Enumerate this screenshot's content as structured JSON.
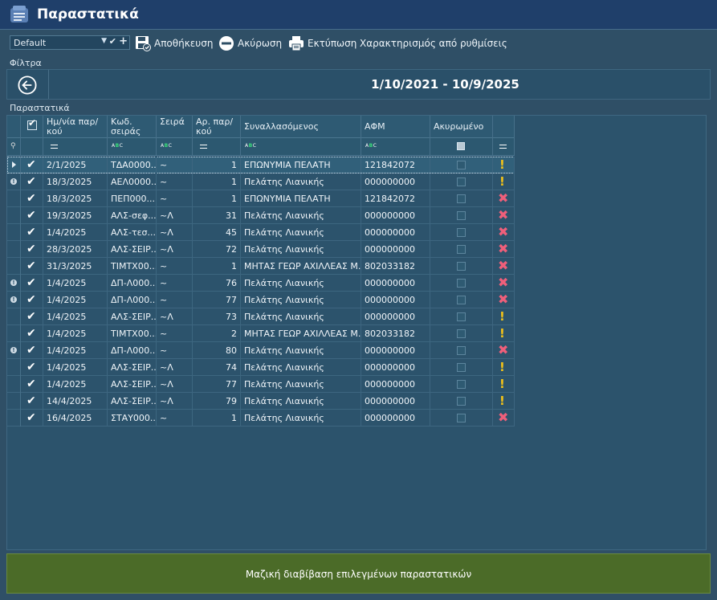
{
  "window": {
    "title": "Παραστατικά"
  },
  "toolbar": {
    "layout_value": "Default",
    "save_label": "Αποθήκευση",
    "cancel_label": "Ακύρωση",
    "print_label": "Εκτύπωση",
    "settings_label": "Χαρακτηρισμός από ρυθμίσεις"
  },
  "filters": {
    "label": "Φίλτρα",
    "date_range": "1/10/2021 - 10/9/2025"
  },
  "grid": {
    "label": "Παραστατικά",
    "columns": {
      "date": "Ημ/νία παρ/κού",
      "series_code": "Κωδ. σειράς",
      "series": "Σειρά",
      "number": "Αρ. παρ/κού",
      "party": "Συναλλασόμενος",
      "vat": "ΑΦΜ",
      "cancelled": "Ακυρωμένο"
    },
    "rows": [
      {
        "date": "2/1/2025",
        "code": "ΤΔΑ0000...",
        "series": "~",
        "num": "1",
        "party": "ΕΠΩΝΥΜΙΑ ΠΕΛΑΤΗ",
        "vat": "121842072",
        "status": "warn",
        "flag": false,
        "selected": true
      },
      {
        "date": "18/3/2025",
        "code": "ΑΕΛ0000...",
        "series": "~",
        "num": "1",
        "party": "Πελάτης Λιανικής",
        "vat": "000000000",
        "status": "warn",
        "flag": true,
        "selected": false
      },
      {
        "date": "18/3/2025",
        "code": "ΠΕΠ000...",
        "series": "~",
        "num": "1",
        "party": "ΕΠΩΝΥΜΙΑ ΠΕΛΑΤΗ",
        "vat": "121842072",
        "status": "error",
        "flag": false,
        "selected": false
      },
      {
        "date": "19/3/2025",
        "code": "ΑΛΣ-σεφ...",
        "series": "~Λ",
        "num": "31",
        "party": "Πελάτης Λιανικής",
        "vat": "000000000",
        "status": "error",
        "flag": false,
        "selected": false
      },
      {
        "date": "1/4/2025",
        "code": "ΑΛΣ-τεσ...",
        "series": "~Λ",
        "num": "45",
        "party": "Πελάτης Λιανικής",
        "vat": "000000000",
        "status": "error",
        "flag": false,
        "selected": false
      },
      {
        "date": "28/3/2025",
        "code": "ΑΛΣ-ΣΕΙΡ...",
        "series": "~Λ",
        "num": "72",
        "party": "Πελάτης Λιανικής",
        "vat": "000000000",
        "status": "error",
        "flag": false,
        "selected": false
      },
      {
        "date": "31/3/2025",
        "code": "ΤΙΜΤΧ00...",
        "series": "~",
        "num": "1",
        "party": "ΜΗΤΑΣ ΓΕΩΡ  ΑΧΙΛΛΕΑΣ Μ...",
        "vat": "802033182",
        "status": "error",
        "flag": false,
        "selected": false
      },
      {
        "date": "1/4/2025",
        "code": "ΔΠ-Λ000...",
        "series": "~",
        "num": "76",
        "party": "Πελάτης Λιανικής",
        "vat": "000000000",
        "status": "error",
        "flag": true,
        "selected": false
      },
      {
        "date": "1/4/2025",
        "code": "ΔΠ-Λ000...",
        "series": "~",
        "num": "77",
        "party": "Πελάτης Λιανικής",
        "vat": "000000000",
        "status": "error",
        "flag": true,
        "selected": false
      },
      {
        "date": "1/4/2025",
        "code": "ΑΛΣ-ΣΕΙΡ...",
        "series": "~Λ",
        "num": "73",
        "party": "Πελάτης Λιανικής",
        "vat": "000000000",
        "status": "warn",
        "flag": false,
        "selected": false
      },
      {
        "date": "1/4/2025",
        "code": "ΤΙΜΤΧ00...",
        "series": "~",
        "num": "2",
        "party": "ΜΗΤΑΣ ΓΕΩΡ  ΑΧΙΛΛΕΑΣ Μ...",
        "vat": "802033182",
        "status": "warn",
        "flag": false,
        "selected": false
      },
      {
        "date": "1/4/2025",
        "code": "ΔΠ-Λ000...",
        "series": "~",
        "num": "80",
        "party": "Πελάτης Λιανικής",
        "vat": "000000000",
        "status": "error",
        "flag": true,
        "selected": false
      },
      {
        "date": "1/4/2025",
        "code": "ΑΛΣ-ΣΕΙΡ...",
        "series": "~Λ",
        "num": "74",
        "party": "Πελάτης Λιανικής",
        "vat": "000000000",
        "status": "warn",
        "flag": false,
        "selected": false
      },
      {
        "date": "1/4/2025",
        "code": "ΑΛΣ-ΣΕΙΡ...",
        "series": "~Λ",
        "num": "77",
        "party": "Πελάτης Λιανικής",
        "vat": "000000000",
        "status": "warn",
        "flag": false,
        "selected": false
      },
      {
        "date": "14/4/2025",
        "code": "ΑΛΣ-ΣΕΙΡ...",
        "series": "~Λ",
        "num": "79",
        "party": "Πελάτης Λιανικής",
        "vat": "000000000",
        "status": "warn",
        "flag": false,
        "selected": false
      },
      {
        "date": "16/4/2025",
        "code": "ΣΤΑΥ000...",
        "series": "~",
        "num": "1",
        "party": "Πελάτης Λιανικής",
        "vat": "000000000",
        "status": "error",
        "flag": false,
        "selected": false
      }
    ]
  },
  "bulk_button": "Μαζική διαβίβαση επιλεγμένων παραστατικών",
  "colors": {
    "warn": "#f3c318",
    "error": "#ef5f7a",
    "bulk": "#4b6b28"
  }
}
